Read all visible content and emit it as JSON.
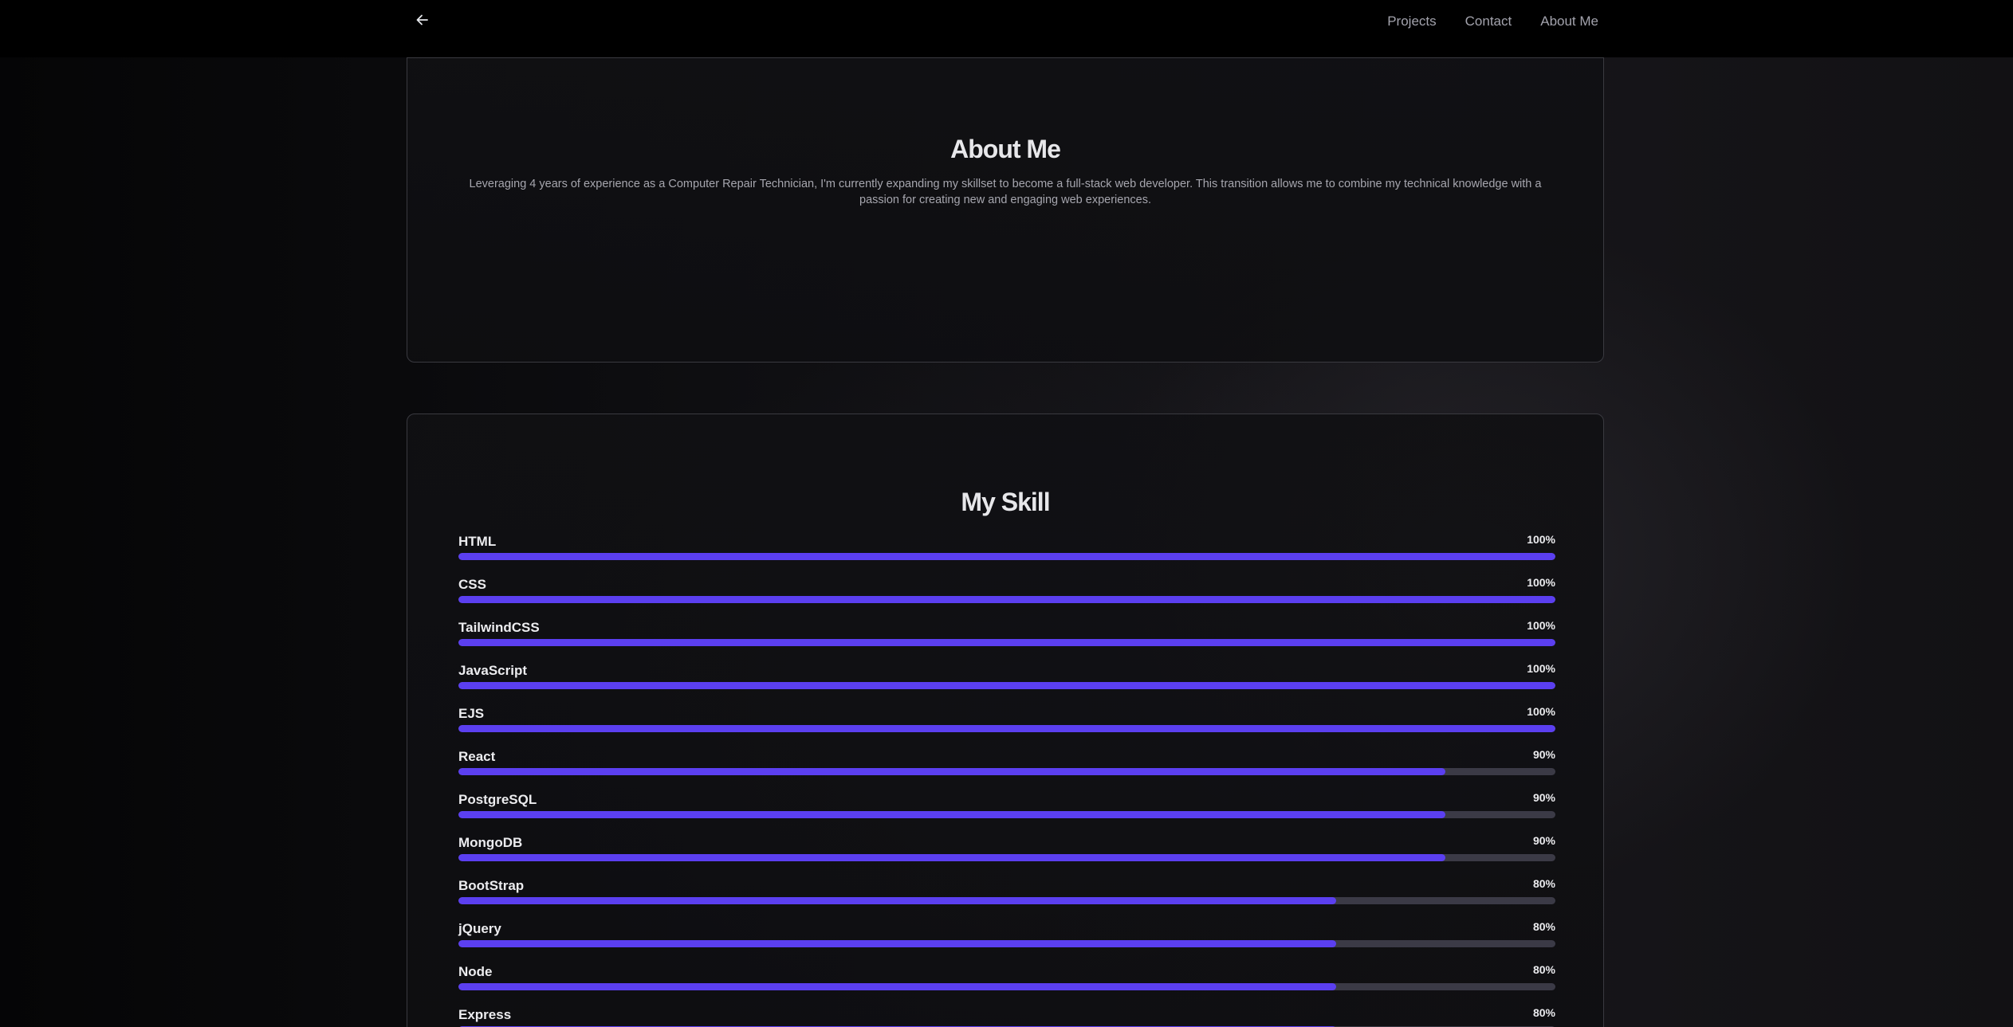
{
  "nav": {
    "back_icon": "arrow-left-icon",
    "links": [
      "Projects",
      "Contact",
      "About Me"
    ]
  },
  "about": {
    "title": "About Me",
    "text": "Leveraging 4 years of experience as a Computer Repair Technician, I'm currently expanding my skillset to become a full-stack web developer. This transition allows me to combine my technical knowledge with a passion for creating new and engaging web experiences."
  },
  "skills": {
    "title": "My Skill",
    "items": [
      {
        "name": "HTML",
        "percent": "100%",
        "value": 100
      },
      {
        "name": "CSS",
        "percent": "100%",
        "value": 100
      },
      {
        "name": "TailwindCSS",
        "percent": "100%",
        "value": 100
      },
      {
        "name": "JavaScript",
        "percent": "100%",
        "value": 100
      },
      {
        "name": "EJS",
        "percent": "100%",
        "value": 100
      },
      {
        "name": "React",
        "percent": "90%",
        "value": 90
      },
      {
        "name": "PostgreSQL",
        "percent": "90%",
        "value": 90
      },
      {
        "name": "MongoDB",
        "percent": "90%",
        "value": 90
      },
      {
        "name": "BootStrap",
        "percent": "80%",
        "value": 80
      },
      {
        "name": "jQuery",
        "percent": "80%",
        "value": 80
      },
      {
        "name": "Node",
        "percent": "80%",
        "value": 80
      },
      {
        "name": "Express",
        "percent": "80%",
        "value": 80
      }
    ]
  },
  "colors": {
    "accent": "#5b3ff0",
    "track": "#3b3a46",
    "background": "#0b0b0d"
  }
}
